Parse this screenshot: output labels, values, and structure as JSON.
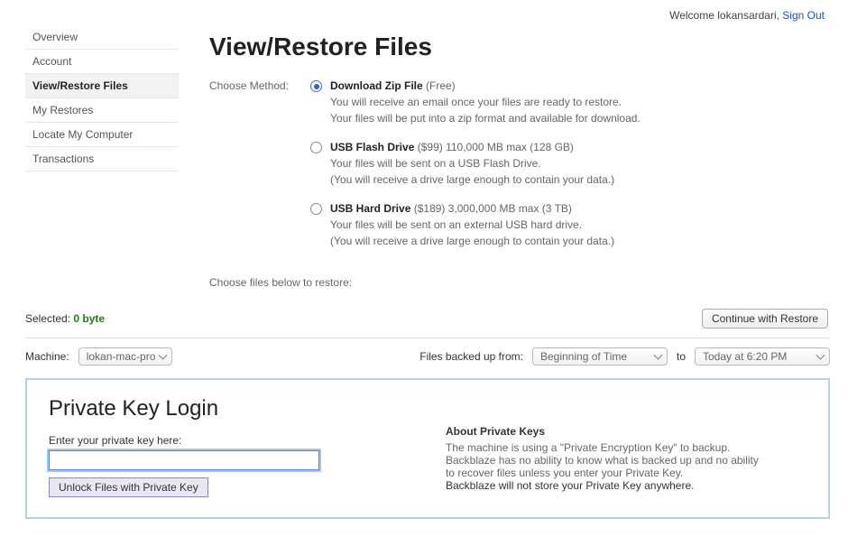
{
  "header": {
    "welcome_prefix": "Welcome ",
    "username": "lokansardari",
    "signout": "Sign Out"
  },
  "sidebar": {
    "items": [
      {
        "label": "Overview"
      },
      {
        "label": "Account"
      },
      {
        "label": "View/Restore Files"
      },
      {
        "label": "My Restores"
      },
      {
        "label": "Locate My Computer"
      },
      {
        "label": "Transactions"
      }
    ],
    "active_index": 2
  },
  "page": {
    "title": "View/Restore Files",
    "choose_method_label": "Choose Method:",
    "choose_files_label": "Choose files below to restore:"
  },
  "methods": [
    {
      "title": "Download Zip File",
      "price": "(Free)",
      "line1": "You will receive an email once your files are ready to restore.",
      "line2": "Your files will be put into a zip format and available for download.",
      "checked": true
    },
    {
      "title": "USB Flash Drive",
      "price": "($99) 110,000 MB max (128 GB)",
      "line1": "Your files will be sent on a USB Flash Drive.",
      "line2": "(You will receive a drive large enough to contain your data.)",
      "checked": false
    },
    {
      "title": "USB Hard Drive",
      "price": "($189) 3,000,000 MB max (3 TB)",
      "line1": "Your files will be sent on an external USB hard drive.",
      "line2": "(You will receive a drive large enough to contain your data.)",
      "checked": false
    }
  ],
  "selected": {
    "label": "Selected: ",
    "value": "0 byte"
  },
  "continue_button": "Continue with Restore",
  "filters": {
    "machine_label": "Machine:",
    "machine_value": "lokan-mac-pro",
    "from_label": "Files backed up from:",
    "from_value": "Beginning of Time",
    "to_label": "to",
    "to_value": "Today at 6:20 PM"
  },
  "private_key": {
    "heading": "Private Key Login",
    "prompt": "Enter your private key here:",
    "value": "",
    "button": "Unlock Files with Private Key",
    "about_title": "About Private Keys",
    "about_1": "The machine is using a \"Private Encryption Key\" to backup.",
    "about_2": "Backblaze has no ability to know what is backed up and no ability",
    "about_3": "to recover files unless you enter your Private Key.",
    "about_4": "Backblaze will not store your Private Key anywhere."
  }
}
